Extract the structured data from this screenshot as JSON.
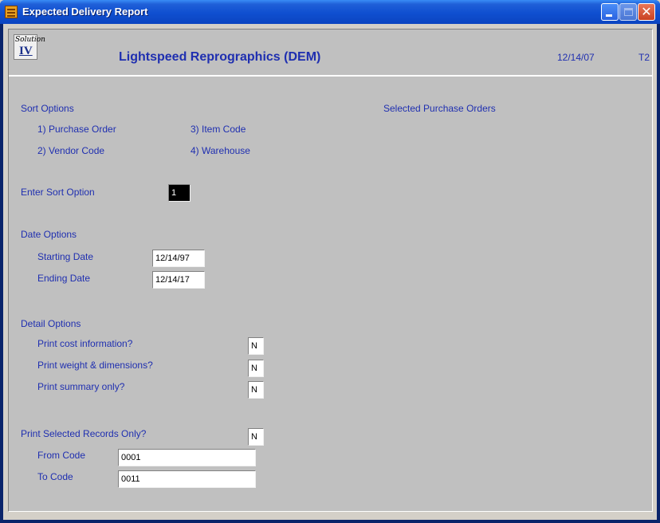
{
  "window": {
    "title": "Expected Delivery Report"
  },
  "header": {
    "logo_top": "Solution",
    "logo_numeral": "IV",
    "company": "Lightspeed Reprographics (DEM)",
    "date": "12/14/07",
    "terminal": "T2"
  },
  "sort": {
    "heading": "Sort Options",
    "options": [
      "1) Purchase Order",
      "2) Vendor Code",
      "3) Item Code",
      "4) Warehouse"
    ],
    "selected_heading": "Selected Purchase Orders",
    "enter_label": "Enter Sort Option",
    "enter_value": "1"
  },
  "date": {
    "heading": "Date Options",
    "start_label": "Starting Date",
    "start_value": "12/14/97",
    "end_label": "Ending Date",
    "end_value": "12/14/17"
  },
  "detail": {
    "heading": "Detail Options",
    "cost_label": "Print cost information?",
    "cost_value": "N",
    "weight_label": "Print weight & dimensions?",
    "weight_value": "N",
    "summary_label": "Print summary only?",
    "summary_value": "N"
  },
  "selection": {
    "label": "Print Selected Records Only?",
    "value": "N",
    "from_label": "From Code",
    "from_value": "0001",
    "to_label": "To Code",
    "to_value": "0011"
  },
  "colors": {
    "label": "#1f2fb0",
    "background": "#c0c0c0",
    "titlebar": "#0f4fd0"
  },
  "icons": {
    "app": "report-grid-icon",
    "minimize": "minimize-icon",
    "maximize": "maximize-icon",
    "close": "close-icon"
  }
}
